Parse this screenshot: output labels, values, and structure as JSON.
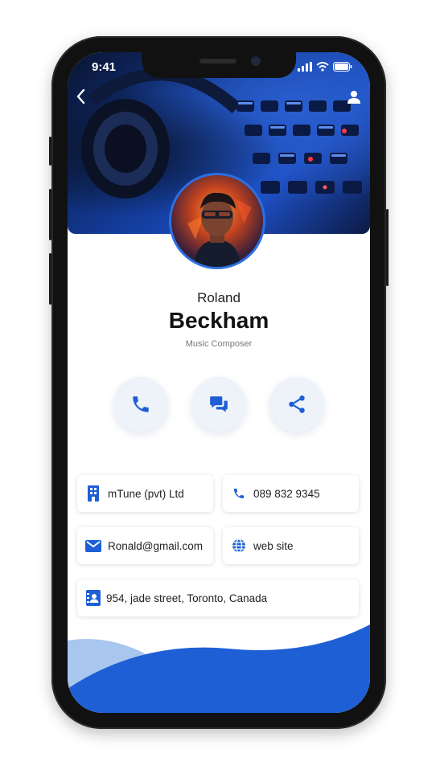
{
  "status_bar": {
    "time": "9:41"
  },
  "profile": {
    "first_name": "Roland",
    "last_name": "Beckham",
    "role": "Music Composer"
  },
  "actions": [
    {
      "icon": "phone-icon"
    },
    {
      "icon": "chat-icon"
    },
    {
      "icon": "share-icon"
    }
  ],
  "contact": {
    "company": "mTune (pvt) Ltd",
    "phone": "089 832 9345",
    "email": "Ronald@gmail.com",
    "website": "web site",
    "address": "954, jade street, Toronto, Canada"
  },
  "colors": {
    "accent": "#1e5fd6",
    "wave_light": "#a9c6ee",
    "card_bg": "#ffffff"
  }
}
